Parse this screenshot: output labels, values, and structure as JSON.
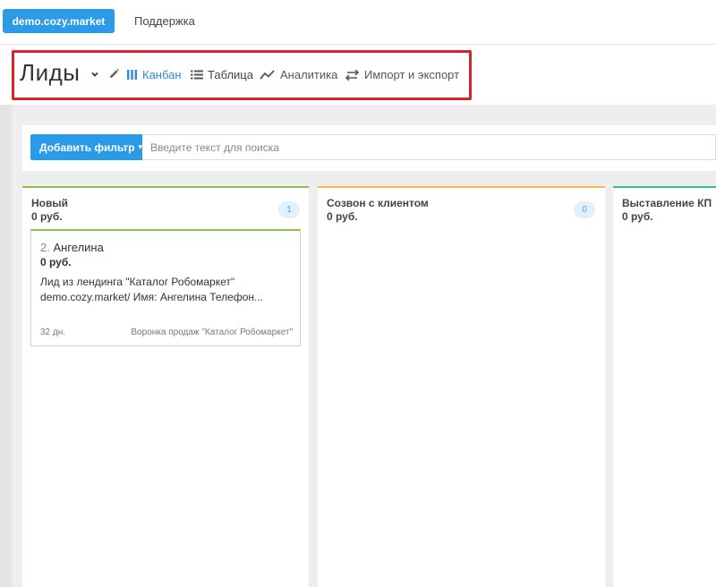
{
  "topbar": {
    "site_label": "demo.cozy.market",
    "support_label": "Поддержка"
  },
  "header": {
    "title": "Лиды",
    "nav": {
      "kanban": "Канбан",
      "table": "Таблица",
      "analytics": "Аналитика",
      "import_export": "Импорт и экспорт"
    },
    "active_view": "kanban"
  },
  "filter": {
    "button_label": "Добавить фильтр",
    "search_placeholder": "Введите текст для поиска",
    "search_value": ""
  },
  "columns": [
    {
      "title": "Новый",
      "sum": "0 руб.",
      "count": "1",
      "color": "#8cc152"
    },
    {
      "title": "Созвон с клиентом",
      "sum": "0 руб.",
      "count": "0",
      "color": "#f6bb42"
    },
    {
      "title": "Выставление КП",
      "sum": "0 руб.",
      "color": "#37bc9b"
    }
  ],
  "cards": [
    {
      "number": "2.",
      "name": "Ангелина",
      "sum": "0  руб.",
      "description": "Лид из лендинга \"Каталог Робомаркет\" demo.cozy.market/ Имя: Ангелина Телефон...",
      "days": "32 дн.",
      "funnel": "Воронка продаж \"Каталог Робомаркет\""
    }
  ],
  "colors": {
    "accent": "#2b9be8",
    "highlight": "#d9232b"
  }
}
